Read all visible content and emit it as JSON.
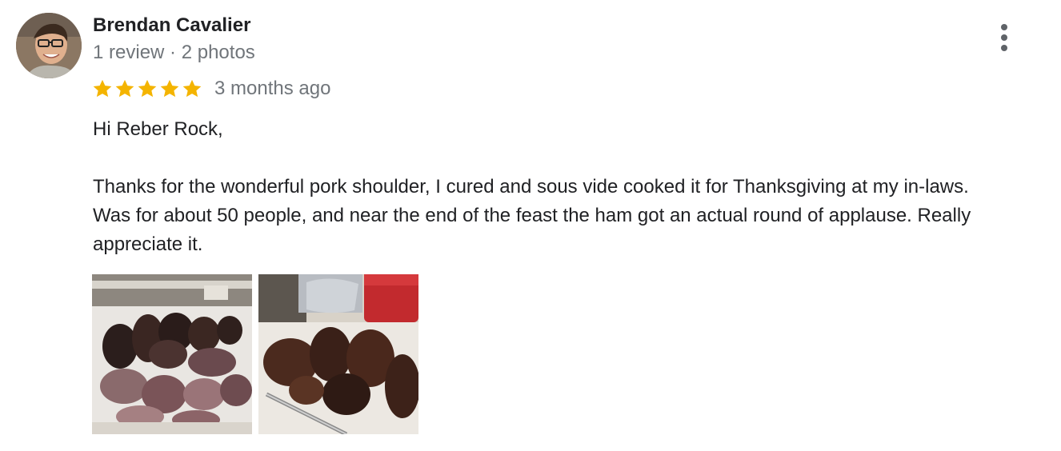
{
  "review": {
    "author": {
      "name": "Brendan Cavalier",
      "review_count": "1 review",
      "separator": "·",
      "photo_count": "2 photos"
    },
    "rating": 5,
    "rating_max": 5,
    "time": "3 months ago",
    "body": {
      "greeting": "Hi Reber Rock,",
      "line1": "Thanks for the wonderful pork shoulder, I cured and sous vide cooked it for Thanksgiving at my in-laws.",
      "line2": "Was for about 50 people, and near the end of the feast the ham got an actual round of applause. Really",
      "line3": "appreciate it."
    },
    "photos": [
      {
        "icon": "food-photo-sliced-meat"
      },
      {
        "icon": "food-photo-ham-pieces"
      }
    ],
    "menu_icon": "more-vert-icon"
  },
  "colors": {
    "star": "#f4b400",
    "name_text": "#202124",
    "meta_text": "#70757a",
    "menu_dots": "#5f6368"
  }
}
